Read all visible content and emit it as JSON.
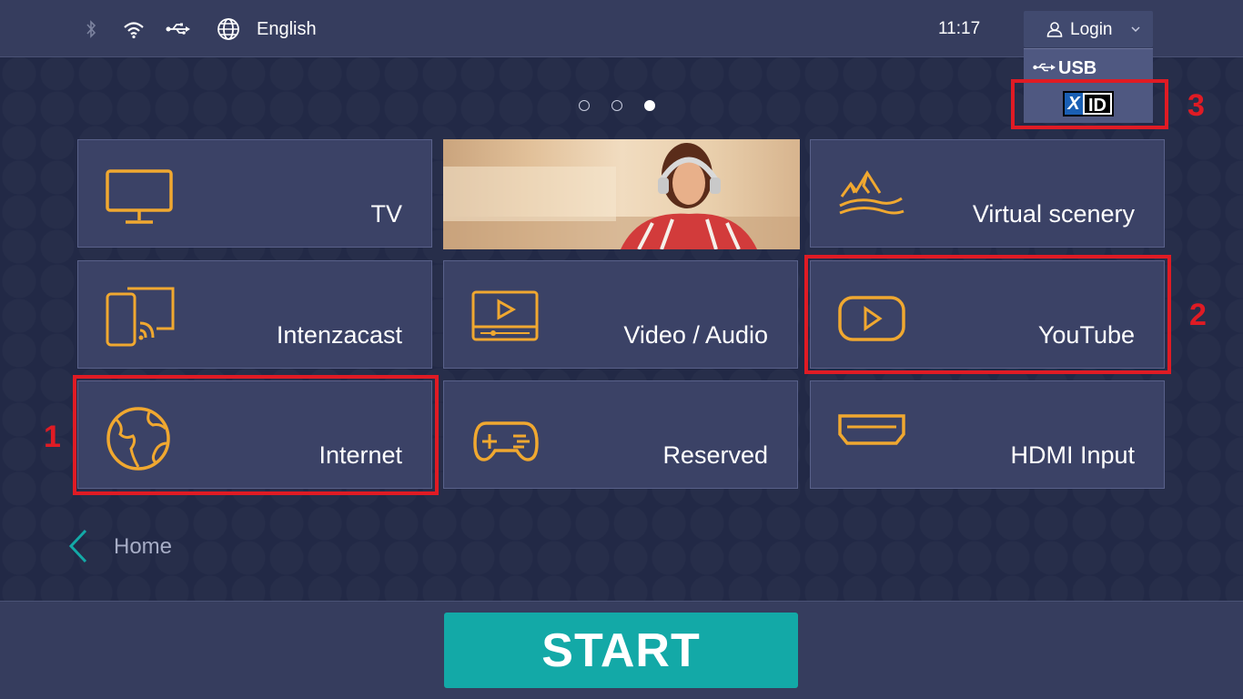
{
  "status_bar": {
    "icons": [
      "bluetooth-icon",
      "wifi-icon",
      "usb-icon",
      "globe-icon"
    ],
    "language": "English",
    "time": "11:17"
  },
  "login": {
    "label": "Login",
    "menu": {
      "usb_label": "USB",
      "xid_x": "X",
      "xid_id": "ID"
    }
  },
  "carousel": {
    "pages": 3,
    "active_page": 3
  },
  "tiles": [
    {
      "label": "TV",
      "icon": "tv-icon"
    },
    {
      "label": "",
      "icon": "banner-image"
    },
    {
      "label": "Virtual scenery",
      "icon": "mountains-icon"
    },
    {
      "label": "Intenzacast",
      "icon": "cast-icon"
    },
    {
      "label": "Video / Audio",
      "icon": "video-player-icon"
    },
    {
      "label": "YouTube",
      "icon": "play-icon"
    },
    {
      "label": "Internet",
      "icon": "globe-icon"
    },
    {
      "label": "Reserved",
      "icon": "gamepad-icon"
    },
    {
      "label": "HDMI Input",
      "icon": "hdmi-icon"
    }
  ],
  "callouts": [
    "1",
    "2",
    "3"
  ],
  "nav": {
    "home_label": "Home"
  },
  "start_button": {
    "label": "START"
  },
  "colors": {
    "accent_icon": "#f0a830",
    "start": "#13a9a7",
    "highlight": "#e01b24",
    "tile_bg": "#3b4266"
  }
}
